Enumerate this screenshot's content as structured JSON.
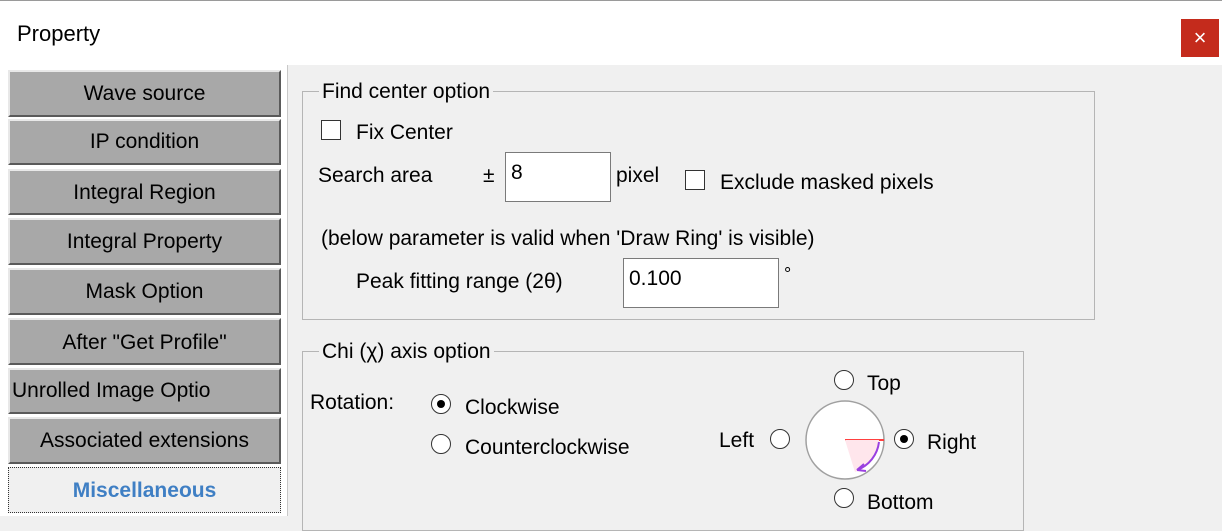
{
  "window": {
    "title": "Property",
    "close_symbol": "×"
  },
  "sidebar": {
    "items": [
      {
        "label": "Wave source"
      },
      {
        "label": "IP condition"
      },
      {
        "label": "Integral Region"
      },
      {
        "label": "Integral Property"
      },
      {
        "label": "Mask Option"
      },
      {
        "label": "After \"Get Profile\""
      },
      {
        "label": "Unrolled  Image Optio"
      },
      {
        "label": "Associated extensions"
      },
      {
        "label": "Miscellaneous"
      }
    ],
    "active": "Miscellaneous"
  },
  "find_center": {
    "legend": "Find center option",
    "fix_center": {
      "label": "Fix Center",
      "checked": false
    },
    "search_area_label": "Search area",
    "plus_minus": "±",
    "search_area_value": "8",
    "search_area_unit": "pixel",
    "exclude_masked": {
      "label": "Exclude masked pixels",
      "checked": false
    },
    "note": "(below parameter is valid when 'Draw Ring' is visible)",
    "peak_fitting_label": "Peak fitting range (2θ)",
    "peak_fitting_value": "0.100",
    "peak_fitting_unit": "°"
  },
  "chi_axis": {
    "legend": "Chi (χ) axis option",
    "rotation_label": "Rotation:",
    "rotation_options": [
      {
        "label": "Clockwise",
        "selected": true
      },
      {
        "label": "Counterclockwise",
        "selected": false
      }
    ],
    "origin_options": [
      {
        "label": "Top",
        "selected": false
      },
      {
        "label": "Left",
        "selected": false
      },
      {
        "label": "Right",
        "selected": true
      },
      {
        "label": "Bottom",
        "selected": false
      }
    ],
    "diagram_colors": {
      "circle": "#a0a0a0",
      "zero_line": "#ff4040",
      "arrow": "#9a40e0"
    }
  }
}
